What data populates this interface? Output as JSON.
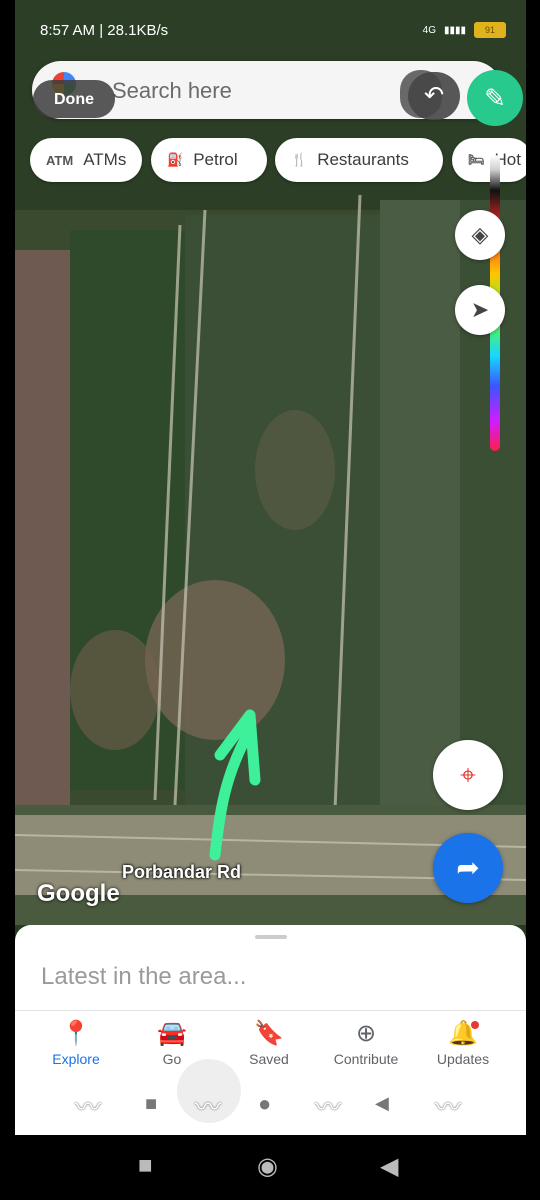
{
  "status_bar": {
    "time_speed": "8:57 AM | 28.1KB/s",
    "network": "4G",
    "battery": "91"
  },
  "search": {
    "placeholder": "Search here",
    "done_label": "Done"
  },
  "chips": [
    {
      "icon": "atm-icon",
      "glyph": "ATM",
      "label": "ATMs"
    },
    {
      "icon": "fuel-icon",
      "glyph": "⛽",
      "label": "Petrol"
    },
    {
      "icon": "restaurant-icon",
      "glyph": "🍴",
      "label": "Restaurants"
    },
    {
      "icon": "hotel-icon",
      "glyph": "🛏",
      "label": "Hot"
    }
  ],
  "map": {
    "road_label": "Porbandar Rd",
    "attribution": "Google"
  },
  "sheet": {
    "title": "Latest in the area..."
  },
  "bottom_nav": [
    {
      "label": "Explore",
      "icon": "location-pin-icon",
      "glyph": "📍",
      "active": true
    },
    {
      "label": "Go",
      "icon": "commute-icon",
      "glyph": "🚘",
      "active": false
    },
    {
      "label": "Saved",
      "icon": "bookmark-icon",
      "glyph": "🔖",
      "active": false
    },
    {
      "label": "Contribute",
      "icon": "add-circle-icon",
      "glyph": "⊕",
      "active": false
    },
    {
      "label": "Updates",
      "icon": "bell-icon",
      "glyph": "🔔",
      "active": false
    }
  ],
  "colors": {
    "accent": "#1a73e8",
    "pen": "#28c98c",
    "drawing_stroke": "#3ef09a"
  }
}
